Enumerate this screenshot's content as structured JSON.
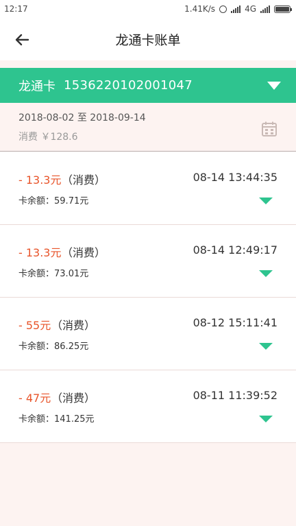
{
  "status_bar": {
    "time": "12:17",
    "network_speed": "1.41K/s",
    "network_type": "4G"
  },
  "header": {
    "title": "龙通卡账单",
    "back_icon": "arrow-left-icon"
  },
  "card": {
    "name": "龙通卡",
    "number": "1536220102001047",
    "toggle_icon": "triangle-down-icon"
  },
  "summary": {
    "date_from": "2018-08-02",
    "date_sep": "至",
    "date_to": "2018-09-14",
    "total_label": "消费",
    "total_value": "￥128.6",
    "calendar_icon": "calendar-icon"
  },
  "transactions": [
    {
      "amount": "- 13.3元",
      "type": "（消费）",
      "time": "08-14 13:44:35",
      "balance_label": "卡余额：",
      "balance": "59.71元"
    },
    {
      "amount": "- 13.3元",
      "type": "（消费）",
      "time": "08-14 12:49:17",
      "balance_label": "卡余额：",
      "balance": "73.01元"
    },
    {
      "amount": "- 55元",
      "type": "（消费）",
      "time": "08-12 15:11:41",
      "balance_label": "卡余额：",
      "balance": "86.25元"
    },
    {
      "amount": "- 47元",
      "type": "（消费）",
      "time": "08-11 11:39:52",
      "balance_label": "卡余额：",
      "balance": "141.25元"
    }
  ],
  "colors": {
    "accent_green": "#2ec48f",
    "amount_red": "#e8542a",
    "page_background": "#fdf3f1"
  }
}
